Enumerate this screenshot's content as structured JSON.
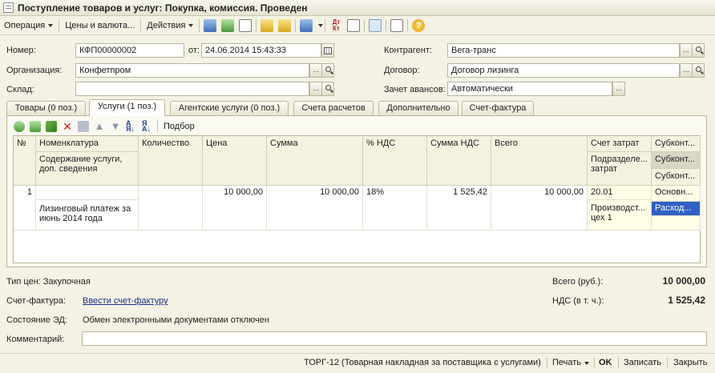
{
  "window": {
    "title": "Поступление товаров и услуг: Покупка, комиссия. Проведен"
  },
  "toolbar": {
    "operation": "Операция",
    "prices": "Цены и валюта...",
    "actions": "Действия"
  },
  "form": {
    "number_label": "Номер:",
    "number_value": "КФП00000002",
    "date_label": "от:",
    "date_value": "24.06.2014 15:43:33",
    "org_label": "Организация:",
    "org_value": "Конфетпром",
    "warehouse_label": "Склад:",
    "warehouse_value": "",
    "counterparty_label": "Контрагент:",
    "counterparty_value": "Вега-транс",
    "contract_label": "Договор:",
    "contract_value": "Договор лизинга",
    "advance_label": "Зачет авансов:",
    "advance_value": "Автоматически"
  },
  "tabs": [
    {
      "label": "Товары (0 поз.)"
    },
    {
      "label": "Услуги (1 поз.)"
    },
    {
      "label": "Агентские услуги (0 поз.)"
    },
    {
      "label": "Счета расчетов"
    },
    {
      "label": "Дополнительно"
    },
    {
      "label": "Счет-фактура"
    }
  ],
  "subtoolbar": {
    "selection": "Подбор"
  },
  "grid": {
    "headers": {
      "num": "№",
      "nomenclature": "Номенклатура",
      "content": "Содержание услуги, доп. сведения",
      "quantity": "Количество",
      "price": "Цена",
      "sum": "Сумма",
      "vat_rate": "% НДС",
      "vat_sum": "Сумма НДС",
      "total": "Всего",
      "cost_account": "Счет затрат ...",
      "subdivision": "Подразделе... затрат",
      "subconto1": "Субконт...",
      "subconto2": "Субконт...",
      "subconto3": "Субконт..."
    },
    "rows": [
      {
        "num": "1",
        "nomenclature": "",
        "content": "Лизинговый платеж за июнь 2014 года",
        "quantity": "",
        "price": "10 000,00",
        "sum": "10 000,00",
        "vat_rate": "18%",
        "vat_sum": "1 525,42",
        "total": "10 000,00",
        "cost_account": "20.01",
        "subdivision": "Производст... цех 1",
        "subconto1": "Основн...",
        "subconto2": "Расход..."
      }
    ]
  },
  "footer": {
    "price_type": "Тип цен: Закупочная",
    "total_label": "Всего (руб.):",
    "total_value": "10 000,00",
    "invoice_label": "Счет-фактура:",
    "invoice_link": "Ввести счет-фактуру",
    "vat_label": "НДС (в т. ч.):",
    "vat_value": "1 525,42",
    "edo_label": "Состояние ЭД:",
    "edo_value": "Обмен электронными документами отключен",
    "comment_label": "Комментарий:",
    "comment_value": ""
  },
  "statusbar": {
    "torg": "ТОРГ-12 (Товарная накладная за поставщика с услугами)",
    "print": "Печать",
    "ok": "OK",
    "save": "Записать",
    "close": "Закрыть"
  }
}
